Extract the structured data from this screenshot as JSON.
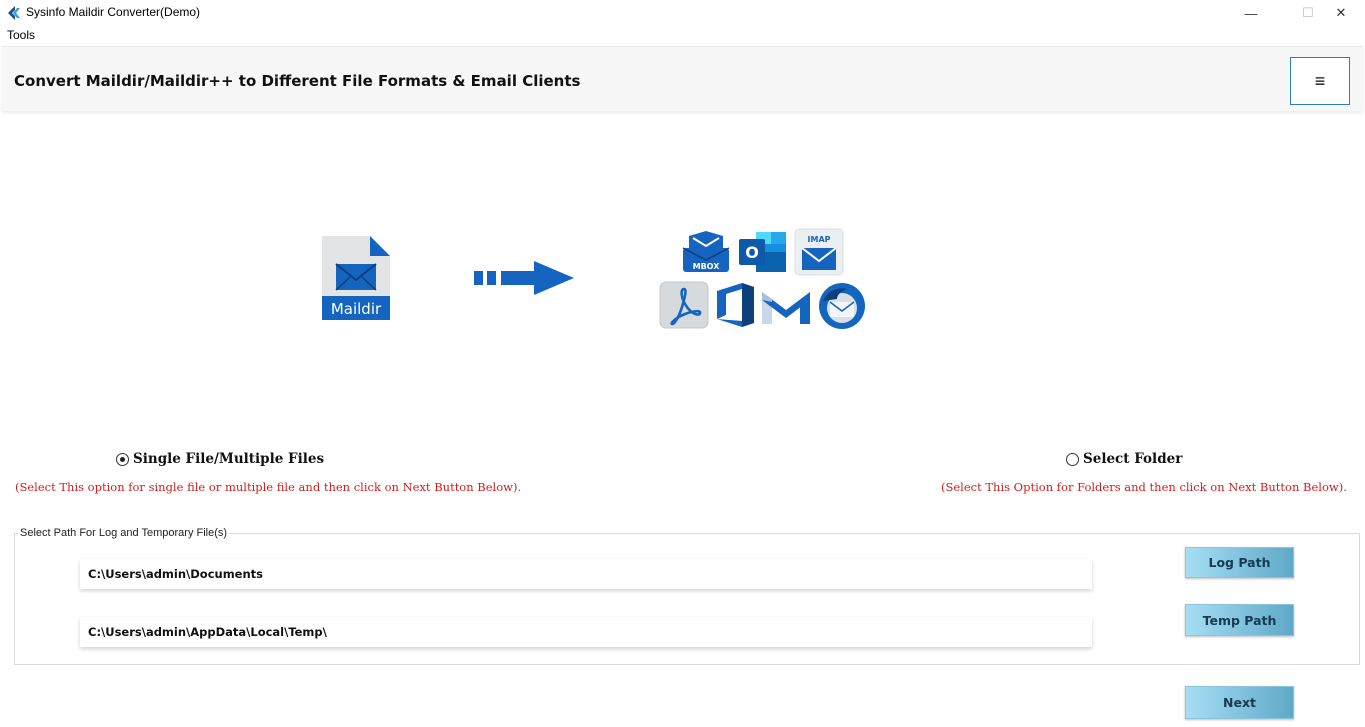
{
  "window": {
    "title": "Sysinfo Maildir Converter(Demo)",
    "minimize_glyph": "—",
    "maximize_glyph": "☐",
    "close_glyph": "✕"
  },
  "menu": {
    "tools": "Tools"
  },
  "header": {
    "title": "Convert Maildir/Maildir++ to Different File Formats & Email Clients",
    "menu_glyph": "≡"
  },
  "illustration": {
    "source_label": "Maildir",
    "mbox_label": "MBOX",
    "imap_label": "IMAP",
    "outlook_letter": "O"
  },
  "options": {
    "single": {
      "label": "Single File/Multiple Files",
      "hint": "(Select This option for single file or multiple file and then click on Next Button Below).",
      "selected": true
    },
    "folder": {
      "label": "Select Folder",
      "hint": "(Select This Option for Folders and then click on Next Button Below).",
      "selected": false
    }
  },
  "paths": {
    "group_label": "Select Path For Log and Temporary File(s)",
    "log_value": "C:\\Users\\admin\\Documents",
    "temp_value": "C:\\Users\\admin\\AppData\\Local\\Temp\\",
    "log_button": "Log Path",
    "temp_button": "Temp Path"
  },
  "footer": {
    "next_button": "Next"
  },
  "colors": {
    "accent_blue": "#1565c0",
    "hint_red": "#d01e1e",
    "button_light": "#a6def4",
    "button_dark": "#5fa9c8"
  }
}
